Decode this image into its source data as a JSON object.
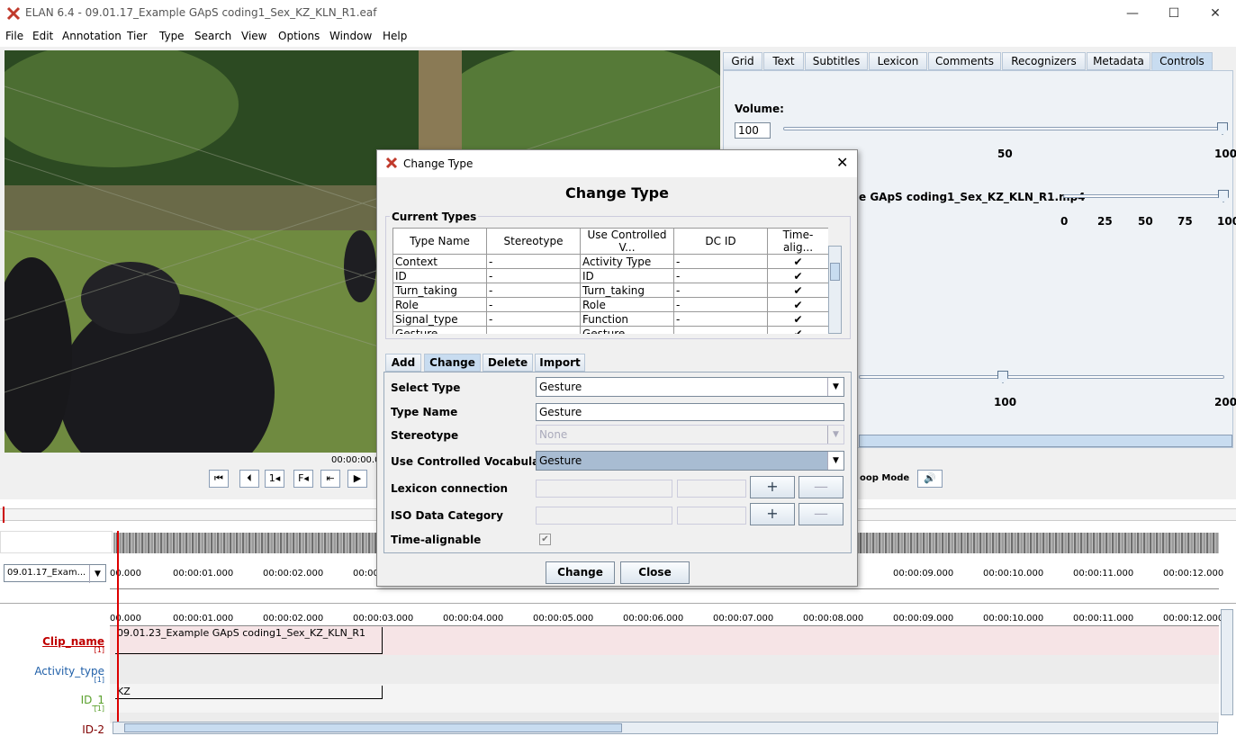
{
  "app": {
    "title": "ELAN 6.4 - 09.01.17_Example GApS coding1_Sex_KZ_KLN_R1.eaf",
    "minimize": "—",
    "maximize": "☐",
    "close": "✕"
  },
  "menu": [
    "File",
    "Edit",
    "Annotation",
    "Tier",
    "Type",
    "Search",
    "View",
    "Options",
    "Window",
    "Help"
  ],
  "tabs": [
    "Grid",
    "Text",
    "Subtitles",
    "Lexicon",
    "Comments",
    "Recognizers",
    "Metadata",
    "Controls"
  ],
  "controls": {
    "volume_label": "Volume:",
    "volume_value": "100",
    "vol_tick_50": "50",
    "vol_tick_100": "100",
    "media_file": "e GApS coding1_Sex_KZ_KLN_R1.mp4",
    "media_ticks": [
      "0",
      "25",
      "50",
      "75",
      "100"
    ],
    "rate_ticks": [
      "100",
      "200"
    ]
  },
  "media": {
    "time": "00:00:00.0",
    "loop_mode": "oop Mode"
  },
  "timeline": {
    "combo": "09.01.17_Exam...",
    "ticks": [
      "00.000",
      "00:00:01.000",
      "00:00:02.000",
      "00:00:03.000",
      "00:00:04.000",
      "00:00:05.000",
      "00:00:06.000",
      "00:00:07.000",
      "00:00:08.000",
      "00:00:09.000",
      "00:00:10.000",
      "00:00:11.000",
      "00:00:12.000"
    ],
    "ticks_top_left": [
      "00.000",
      "00:00:01.000",
      "00:00:02.000",
      "00:00"
    ],
    "ticks_top_right": [
      "00:00:09.000",
      "00:00:10.000",
      "00:00:11.000",
      "00:00:12.000"
    ],
    "tiers": [
      {
        "name": "Clip_name",
        "count": "[1]",
        "color": "#c00000",
        "annotation": "09.01.23_Example GApS coding1_Sex_KZ_KLN_R1"
      },
      {
        "name": "Activity_type",
        "count": "[1]",
        "color": "#1f5fa8",
        "annotation": ""
      },
      {
        "name": "ID_1",
        "count": "[1]",
        "color": "#5aa02c",
        "annotation": "KZ"
      },
      {
        "name": "ID-2",
        "count": "",
        "color": "#800000",
        "annotation": ""
      }
    ]
  },
  "dialog": {
    "title": "Change Type",
    "heading": "Change Type",
    "current_types_label": "Current Types",
    "columns": [
      "Type Name",
      "Stereotype",
      "Use Controlled V...",
      "DC ID",
      "Time-alig..."
    ],
    "rows": [
      [
        "Context",
        "-",
        "Activity Type",
        "-",
        "✔"
      ],
      [
        "ID",
        "-",
        "ID",
        "-",
        "✔"
      ],
      [
        "Turn_taking",
        "-",
        "Turn_taking",
        "-",
        "✔"
      ],
      [
        "Role",
        "-",
        "Role",
        "-",
        "✔"
      ],
      [
        "Signal_type",
        "-",
        "Function",
        "-",
        "✔"
      ],
      [
        "Gesture",
        "-",
        "Gesture",
        "-",
        "✔"
      ]
    ],
    "tabs": [
      "Add",
      "Change",
      "Delete",
      "Import"
    ],
    "labels": {
      "select_type": "Select Type",
      "type_name": "Type Name",
      "stereotype": "Stereotype",
      "use_cv": "Use Controlled Vocabulary",
      "lexicon": "Lexicon connection",
      "iso": "ISO Data Category",
      "time_alignable": "Time-alignable"
    },
    "values": {
      "select_type": "Gesture",
      "type_name": "Gesture",
      "stereotype": "None",
      "use_cv": "Gesture"
    },
    "plus": "+",
    "minus": "—",
    "change_btn": "Change",
    "close_btn": "Close"
  },
  "colors": {
    "accent": "#c8dcf0",
    "tier_bg": "#f6e4e6"
  }
}
